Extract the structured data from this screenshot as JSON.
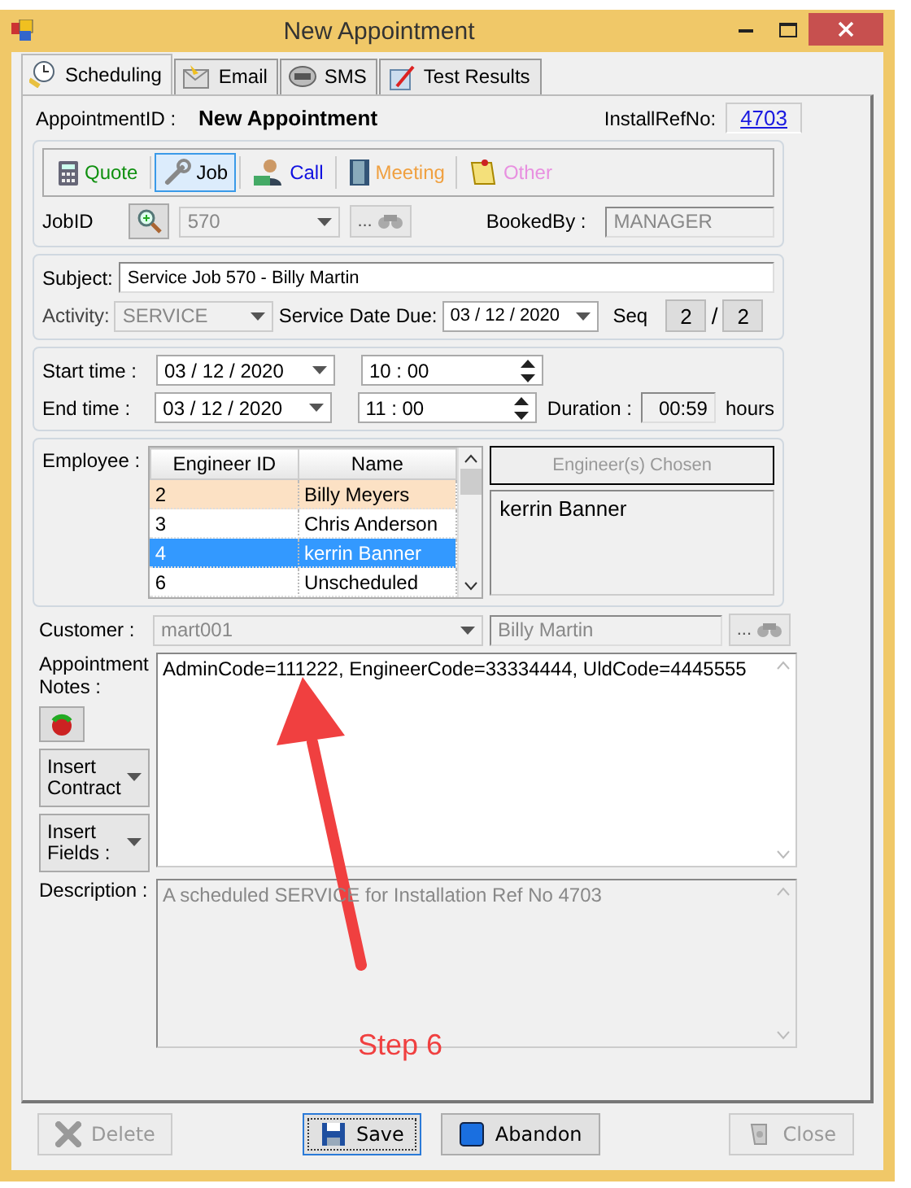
{
  "window": {
    "title": "New Appointment"
  },
  "tabs": [
    {
      "label": "Scheduling",
      "selected": true
    },
    {
      "label": "Email",
      "selected": false
    },
    {
      "label": "SMS",
      "selected": false
    },
    {
      "label": "Test Results",
      "selected": false
    }
  ],
  "appointment": {
    "id_label": "AppointmentID :",
    "id_value": "New Appointment",
    "install_ref_label": "InstallRefNo:",
    "install_ref_value": "4703"
  },
  "job_types": [
    {
      "label": "Quote",
      "kind": "quote",
      "color": "#109010",
      "selected": false
    },
    {
      "label": "Job",
      "kind": "job",
      "color": "#000000",
      "selected": true
    },
    {
      "label": "Call",
      "kind": "call",
      "color": "#1010e0",
      "selected": false
    },
    {
      "label": "Meeting",
      "kind": "meeting",
      "color": "#f0a040",
      "selected": false
    },
    {
      "label": "Other",
      "kind": "other",
      "color": "#e890e0",
      "selected": false
    }
  ],
  "job": {
    "label": "JobID",
    "value": "570",
    "lookup_button": "...",
    "booked_by_label": "BookedBy :",
    "booked_by_value": "MANAGER"
  },
  "subject": {
    "label": "Subject:",
    "value": "Service Job 570 - Billy Martin"
  },
  "activity": {
    "label": "Activity:",
    "value": "SERVICE"
  },
  "service_date": {
    "label": "Service Date Due:",
    "value": "03 / 12 / 2020"
  },
  "seq": {
    "label": "Seq",
    "current": "2",
    "separator": "/",
    "total": "2"
  },
  "times": [
    {
      "label": "Start time :",
      "date": "03 / 12 / 2020",
      "time": "10 : 00"
    },
    {
      "label": "End time :",
      "date": "03 / 12 / 2020",
      "time": "11 : 00"
    }
  ],
  "duration": {
    "label": "Duration :",
    "value": "00:59",
    "unit": "hours"
  },
  "employee": {
    "label": "Employee :",
    "columns": [
      "Engineer ID",
      "Name"
    ],
    "rows": [
      {
        "id": "2",
        "name": "Billy Meyers",
        "highlighted": true,
        "selected": false
      },
      {
        "id": "3",
        "name": "Chris Anderson",
        "highlighted": false,
        "selected": false
      },
      {
        "id": "4",
        "name": "kerrin Banner",
        "highlighted": false,
        "selected": true
      },
      {
        "id": "6",
        "name": "Unscheduled",
        "highlighted": false,
        "selected": false
      }
    ],
    "chosen_header": "Engineer(s) Chosen",
    "chosen": [
      "kerrin Banner"
    ]
  },
  "customer": {
    "label": "Customer :",
    "code": "mart001",
    "name": "Billy Martin",
    "lookup_button": "..."
  },
  "notes": {
    "label": "Appointment Notes :",
    "value": "AdminCode=111222, EngineerCode=33334444, UldCode=4445555",
    "buttons": [
      {
        "label": "Insert Contract"
      },
      {
        "label": "Insert Fields :"
      }
    ]
  },
  "description": {
    "label": "Description :",
    "value": "A scheduled SERVICE for Installation Ref No 4703"
  },
  "annotation": {
    "text": "Step 6"
  },
  "buttons": [
    {
      "label": "Delete",
      "kind": "delete",
      "disabled": true,
      "focused": false
    },
    {
      "label": "Save",
      "kind": "save",
      "disabled": false,
      "focused": true
    },
    {
      "label": "Abandon",
      "kind": "abandon",
      "disabled": false,
      "focused": false
    },
    {
      "label": "Close",
      "kind": "close",
      "disabled": true,
      "focused": false
    }
  ]
}
